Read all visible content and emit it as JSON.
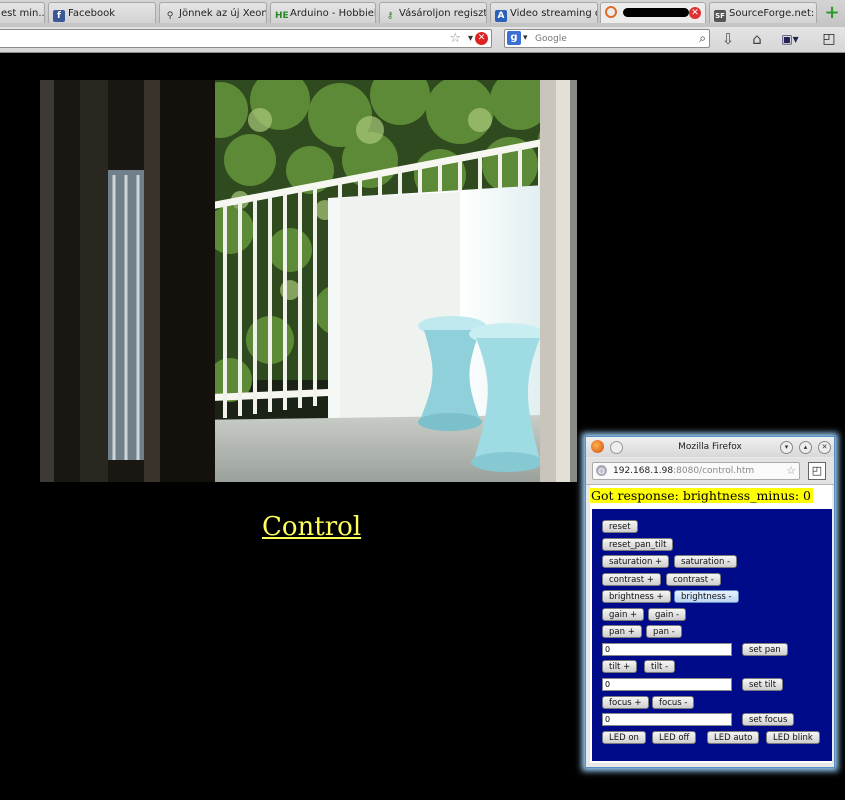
{
  "tabs": [
    {
      "label": "est min...",
      "icon": "page-icon"
    },
    {
      "label": "Facebook",
      "icon": "facebook-icon"
    },
    {
      "label": "Jönnek az új Xeon...",
      "icon": "search-icon"
    },
    {
      "label": "Arduino - Hobbiel...",
      "icon": "he-icon"
    },
    {
      "label": "Vásároljon regiszt...",
      "icon": "key-icon"
    },
    {
      "label": "Video streaming o...",
      "icon": "ac-icon"
    },
    {
      "label": "",
      "icon": "loading-icon"
    },
    {
      "label": "SourceForge.net: ...",
      "icon": "sourceforge-icon"
    }
  ],
  "search": {
    "engine": "Google",
    "placeholder": "Google"
  },
  "page": {
    "control_link": "Control"
  },
  "popup": {
    "title": "Mozilla Firefox",
    "url_host": "192.168.1.98",
    "url_rest": ":8080/control.htm",
    "response": "Got response: brightness_minus: 0",
    "buttons": {
      "reset": "reset",
      "reset_pan_tilt": "reset_pan_tilt",
      "saturation_plus": "saturation +",
      "saturation_minus": "saturation -",
      "contrast_plus": "contrast +",
      "contrast_minus": "contrast -",
      "brightness_plus": "brightness +",
      "brightness_minus": "brightness -",
      "gain_plus": "gain +",
      "gain_minus": "gain -",
      "pan_plus": "pan +",
      "pan_minus": "pan -",
      "set_pan": "set pan",
      "tilt_plus": "tilt +",
      "tilt_minus": "tilt -",
      "set_tilt": "set tilt",
      "focus_plus": "focus +",
      "focus_minus": "focus -",
      "set_focus": "set focus",
      "led_on": "LED on",
      "led_off": "LED off",
      "led_auto": "LED auto",
      "led_blink": "LED blink"
    },
    "fields": {
      "pan": "0",
      "tilt": "0",
      "focus": "0"
    }
  },
  "colors": {
    "link": "#ffff5a",
    "panel": "#000b8a",
    "response_bg": "#ffff00",
    "glow": "#9fd4ff"
  }
}
